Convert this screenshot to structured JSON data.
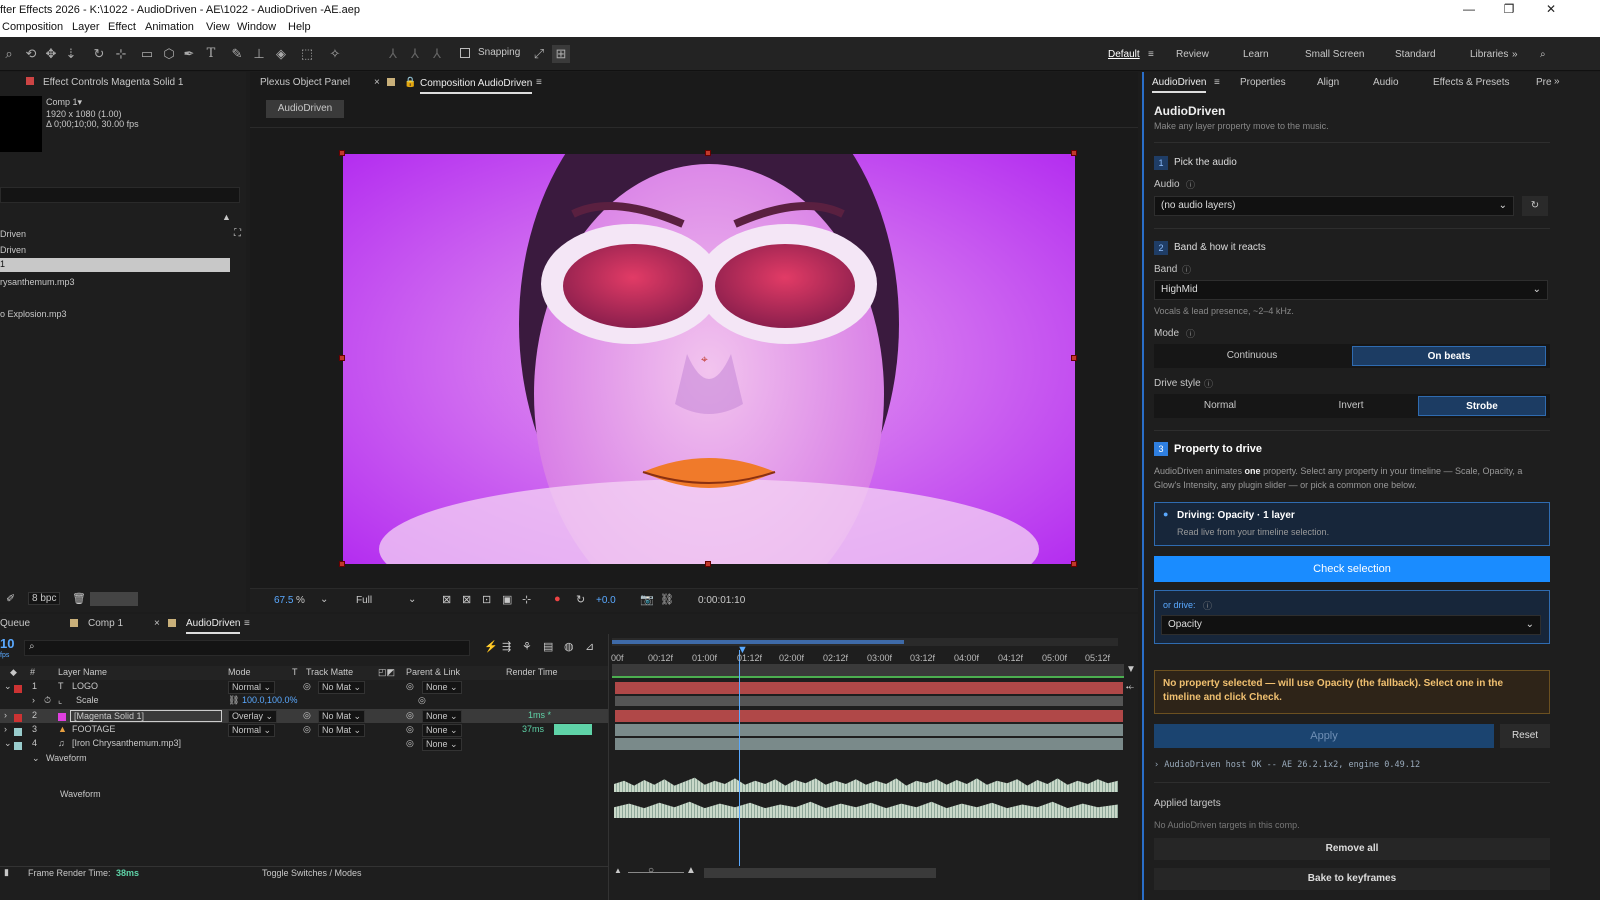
{
  "app": {
    "title": "fter Effects 2026 - K:\\1022 - AudioDriven - AE\\1022 - AudioDriven -AE.aep",
    "controls": [
      "—",
      "❐",
      "✕"
    ]
  },
  "menu": [
    "Composition",
    "Layer",
    "Effect",
    "Animation",
    "View",
    "Window",
    "Help"
  ],
  "toolbar": {
    "snapping": "Snapping"
  },
  "workspaces": [
    "Default",
    "Review",
    "Learn",
    "Small Screen",
    "Standard",
    "Libraries"
  ],
  "effect_controls": {
    "tab": "Effect Controls Magenta Solid 1",
    "comp": "Comp 1▾",
    "res": "1920 x 1080 (1.00)",
    "dur": "Δ 0;00;10;00, 30.00 fps",
    "items": [
      "Driven",
      "Driven",
      "1",
      "rysanthemum.mp3",
      "o Explosion.mp3"
    ],
    "bpc": "8 bpc"
  },
  "viewer": {
    "tab_plexus": "Plexus Object Panel",
    "tab_comp": "Composition AudioDriven",
    "crumb": "AudioDriven",
    "zoom": "67.5",
    "zoom_unit": "%",
    "quality": "Full",
    "exposure": "+0.0",
    "timecode": "0:00:01:10"
  },
  "timeline": {
    "tabs": [
      "Queue",
      "Comp 1",
      "AudioDriven"
    ],
    "fps": "10",
    "fps_sub": "fps",
    "headers": {
      "num": "#",
      "name": "Layer Name",
      "mode": "Mode",
      "t": "T",
      "matte": "Track Matte",
      "parent": "Parent & Link",
      "render": "Render Time"
    },
    "ticks": [
      "00f",
      "00:12f",
      "01:00f",
      "01:12f",
      "02:00f",
      "02:12f",
      "03:00f",
      "03:12f",
      "04:00f",
      "04:12f",
      "05:00f",
      "05:12f"
    ],
    "layers": [
      {
        "num": "1",
        "name": "LOGO",
        "mode": "Normal",
        "matte": "No Mat",
        "parent": "None",
        "render": ""
      },
      {
        "num": "",
        "name": "Scale",
        "mode": "",
        "matte": "",
        "parent": "",
        "render": "",
        "value": "100.0,100.0%"
      },
      {
        "num": "2",
        "name": "[Magenta Solid 1]",
        "mode": "Overlay",
        "matte": "No Mat",
        "parent": "None",
        "render": "1ms *"
      },
      {
        "num": "3",
        "name": "FOOTAGE",
        "mode": "Normal",
        "matte": "No Mat",
        "parent": "None",
        "render": "37ms"
      },
      {
        "num": "4",
        "name": "[Iron Chrysanthemum.mp3]",
        "mode": "",
        "matte": "",
        "parent": "None",
        "render": ""
      }
    ],
    "waveform": [
      "Waveform",
      "Waveform"
    ],
    "footer_left": "Frame Render Time:",
    "footer_ms": "38ms",
    "footer_toggle": "Toggle Switches / Modes"
  },
  "ad": {
    "tabs": [
      "AudioDriven",
      "Properties",
      "Align",
      "Audio",
      "Effects & Presets",
      "Pre"
    ],
    "title": "AudioDriven",
    "subtitle": "Make any layer property move to the music.",
    "s1_num": "1",
    "s1": "Pick the audio",
    "audio_label": "Audio",
    "audio_value": "(no audio layers)",
    "s2_num": "2",
    "s2": "Band & how it reacts",
    "band_label": "Band",
    "band_value": "HighMid",
    "band_hint": "Vocals & lead presence, ~2–4 kHz.",
    "mode_label": "Mode",
    "mode_opts": [
      "Continuous",
      "On beats"
    ],
    "drive_label": "Drive style",
    "drive_opts": [
      "Normal",
      "Invert",
      "Strobe"
    ],
    "s3_num": "3",
    "s3": "Property to drive",
    "desc_a": "AudioDriven animates ",
    "desc_b": "one",
    "desc_c": " property. Select any property in your timeline — Scale, Opacity, a Glow's Intensity, any plugin slider — or pick a common one below.",
    "driving": "Driving: Opacity · 1 layer",
    "driving_sub": "Read live from your timeline selection.",
    "check": "Check selection",
    "or_drive": "or drive:",
    "or_drive_value": "Opacity",
    "warn": "No property selected — will use Opacity (the fallback). Select one in the timeline and click Check.",
    "apply": "Apply",
    "reset": "Reset",
    "log": "› AudioDriven host OK -- AE 26.2.1x2, engine 0.49.12",
    "applied": "Applied targets",
    "none": "No AudioDriven targets in this comp.",
    "remove": "Remove all",
    "bake": "Bake to keyframes"
  }
}
